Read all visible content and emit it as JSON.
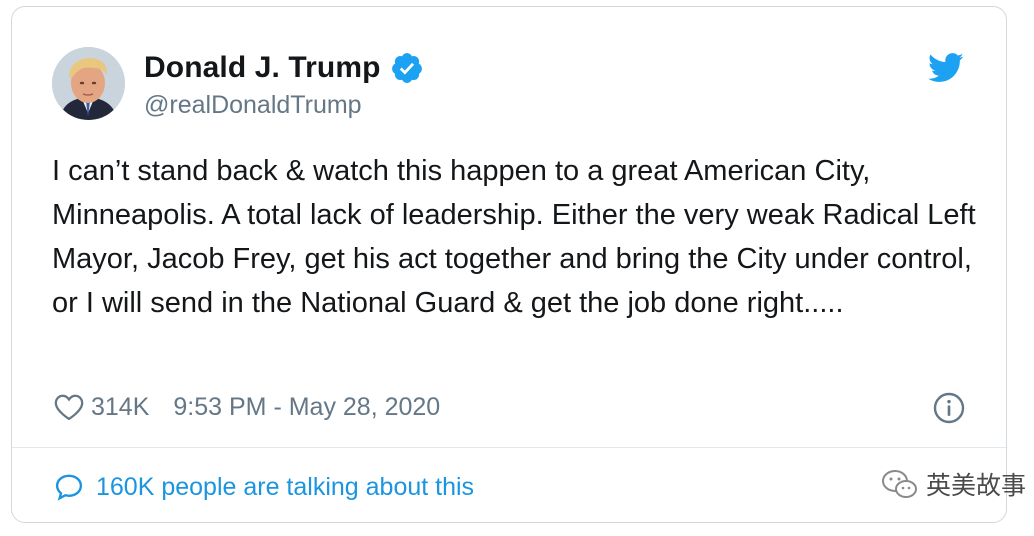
{
  "tweet": {
    "display_name": "Donald J. Trump",
    "handle": "@realDonaldTrump",
    "verified_icon": "verified-badge-icon",
    "brand_icon": "twitter-bird-icon",
    "text": "I can’t stand back & watch this happen to a great American City, Minneapolis. A total lack of leadership. Either the very weak Radical Left Mayor, Jacob Frey, get his act together and bring the City under control, or I will send in the National Guard & get the job done right.....",
    "likes": "314K",
    "timestamp": "9:53 PM - May 28, 2020",
    "talking": "160K people are talking about this"
  },
  "watermark": {
    "text": "英美故事",
    "icon": "wechat-icon"
  },
  "colors": {
    "accent": "#1b95e0",
    "text": "#14171a",
    "secondary": "#657786",
    "border": "#cfd9de"
  }
}
